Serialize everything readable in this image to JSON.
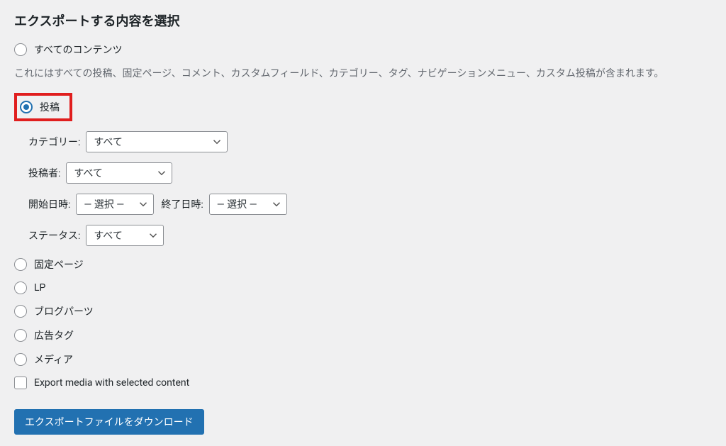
{
  "heading": "エクスポートする内容を選択",
  "options": {
    "all": {
      "label": "すべてのコンテンツ",
      "description": "これにはすべての投稿、固定ページ、コメント、カスタムフィールド、カテゴリー、タグ、ナビゲーションメニュー、カスタム投稿が含まれます。"
    },
    "posts": {
      "label": "投稿"
    },
    "pages": {
      "label": "固定ページ"
    },
    "lp": {
      "label": "LP"
    },
    "blog_parts": {
      "label": "ブログパーツ"
    },
    "ad_tag": {
      "label": "広告タグ"
    },
    "media": {
      "label": "メディア"
    }
  },
  "post_filters": {
    "category": {
      "label": "カテゴリー:",
      "value": "すべて"
    },
    "author": {
      "label": "投稿者:",
      "value": "すべて"
    },
    "start": {
      "label": "開始日時:",
      "value": "— 選択 —"
    },
    "end": {
      "label": "終了日時:",
      "value": "— 選択 —"
    },
    "status": {
      "label": "ステータス:",
      "value": "すべて"
    }
  },
  "export_media_checkbox": {
    "label": "Export media with selected content"
  },
  "download_button": "エクスポートファイルをダウンロード"
}
